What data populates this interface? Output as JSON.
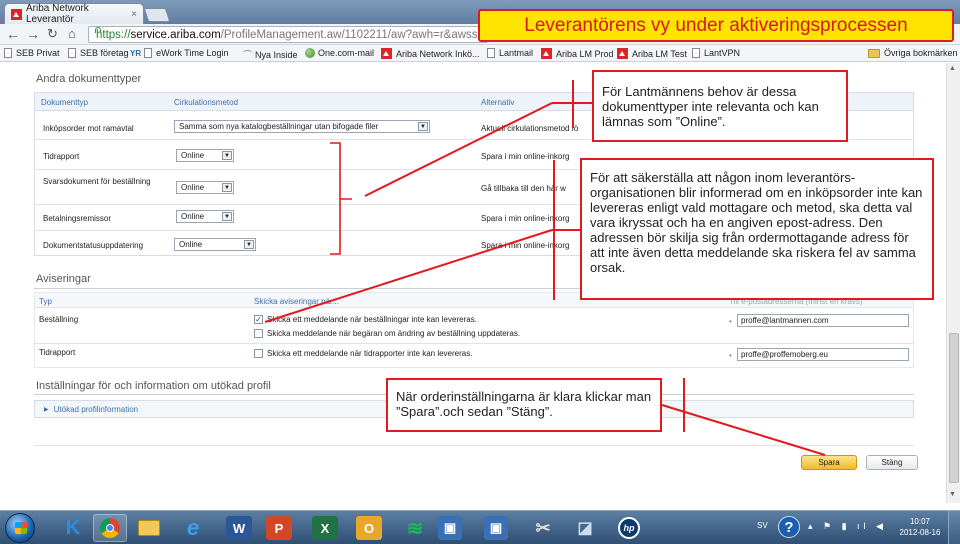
{
  "browser": {
    "tab_title": "Ariba Network Leverantör",
    "tab_close": "×",
    "url_scheme": "https://",
    "url_host": "service.ariba.com",
    "url_path": "/ProfileManagement.aw/1102211/aw?awh=r&awssk=Pr",
    "bookmarks": [
      "SEB Privat",
      "SEB företag",
      "eWork Time Login",
      "Nya Inside",
      "One.com-mail",
      "Ariba Network Inkö...",
      "Lantmail",
      "Ariba LM Prod",
      "Ariba LM Test",
      "LantVPN"
    ],
    "other_bookmarks": "Övriga bokmärken"
  },
  "slide_title": "Leverantörens vy under aktiveringsprocessen",
  "documents": {
    "section_title": "Andra dokumenttyper",
    "headers": [
      "Dokumenttyp",
      "Cirkulationsmetod",
      "Alternativ"
    ],
    "rows": [
      {
        "type": "Inköpsorder mot ramavtal",
        "method": "Samma som nya katalogbeställningar utan bifogade filer",
        "alt": "Aktuell cirkulationsmetod fö"
      },
      {
        "type": "Tidrapport",
        "method": "Online",
        "alt": "Spara i min online-inkorg"
      },
      {
        "type": "Svarsdokument för beställning",
        "method": "Online",
        "alt": "Gå tillbaka till den här w"
      },
      {
        "type": "Betalningsremissor",
        "method": "Online",
        "alt": "Spara i min online-inkorg"
      },
      {
        "type": "Dokumentstatusuppdatering",
        "method": "Online",
        "alt": "Spara i min online-inkorg"
      }
    ]
  },
  "notifications": {
    "section_title": "Aviseringar",
    "headers": [
      "Typ",
      "Skicka aviseringar när...",
      "Till e-postadresserna (minst en krävs)"
    ],
    "rows": [
      {
        "type": "Beställning",
        "opt1": "Skicka ett meddelande när beställningar inte kan levereras.",
        "opt1_checked": true,
        "opt2": "Skicka meddelande när begäran om ändring av beställning uppdateras.",
        "opt2_checked": false,
        "email": "proffe@lantmannen.com"
      },
      {
        "type": "Tidrapport",
        "opt1": "Skicka ett meddelande när tidrapporter inte kan levereras.",
        "opt1_checked": false,
        "email": "proffe@proffemoberg.eu"
      }
    ]
  },
  "profile": {
    "section_title": "Inställningar för och information om utökad profil",
    "expander": "Utökad profilinformation"
  },
  "buttons": {
    "save": "Spara",
    "close": "Stäng"
  },
  "callouts": {
    "c1": "För Lantmännens behov är dessa dokumenttyper inte relevanta och kan lämnas som ”Online”.",
    "c2": "För att säkerställa att någon inom leverantörs-organisationen blir informerad om en inköpsorder inte kan levereras enligt vald mottagare och metod, ska detta val vara ikryssat och ha en angiven epost-adress. Den adressen bör skilja sig från ordermottagande adress för att inte även detta meddelande ska riskera fel av samma orsak.",
    "c3": "När orderinställningarna är klara klickar man ”Spara”.och sedan ”Stäng”."
  },
  "taskbar": {
    "language": "SV",
    "help": "?",
    "time": "10:07",
    "date": "2012-08-16"
  },
  "colors": {
    "accent_red": "#e2191e",
    "title_yellow": "#ffe400",
    "header_blue": "#3f6fa8",
    "save_button": "#f0b92c"
  }
}
